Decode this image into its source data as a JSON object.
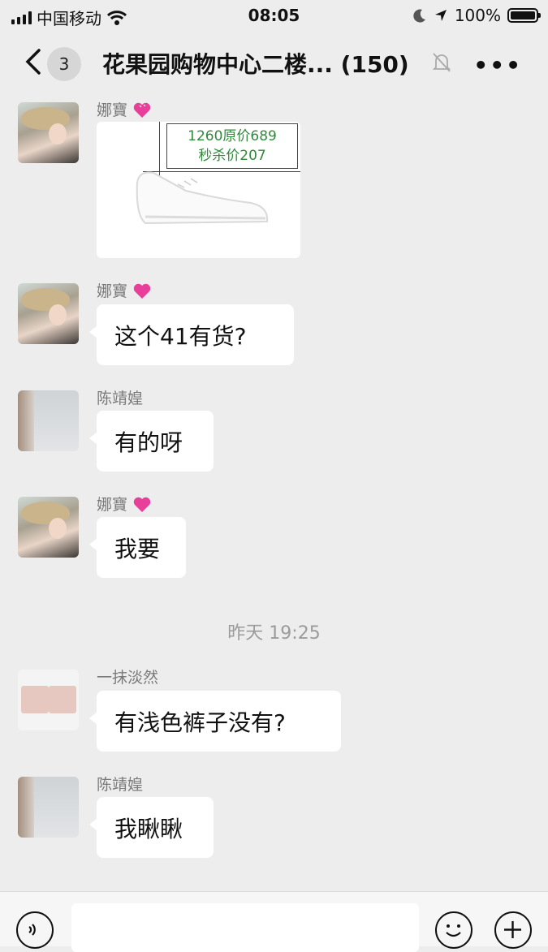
{
  "status": {
    "carrier": "中国移动",
    "time": "08:05",
    "battery": "100%"
  },
  "header": {
    "unread_count": "3",
    "title": "花果园购物中心二楼...",
    "member_count": "(150)"
  },
  "messages": [
    {
      "sender": "娜寶",
      "type": "image",
      "price_line1": "1260原价689",
      "price_line2": "秒杀价207"
    },
    {
      "sender": "娜寶",
      "text": "这个41有货?"
    },
    {
      "sender": "陈靖媓",
      "text": "有的呀"
    },
    {
      "sender": "娜寶",
      "text": "我要"
    },
    {
      "timestamp": "昨天 19:25"
    },
    {
      "sender": "一抹淡然",
      "text": "有浅色裤子没有?"
    },
    {
      "sender": "陈靖媓",
      "text": "我瞅瞅"
    }
  ],
  "colors": {
    "background": "#ededed",
    "bubble": "#ffffff",
    "price_text": "#2e8b3a",
    "name_text": "#7a7a7a",
    "heart": "#e8409a"
  }
}
